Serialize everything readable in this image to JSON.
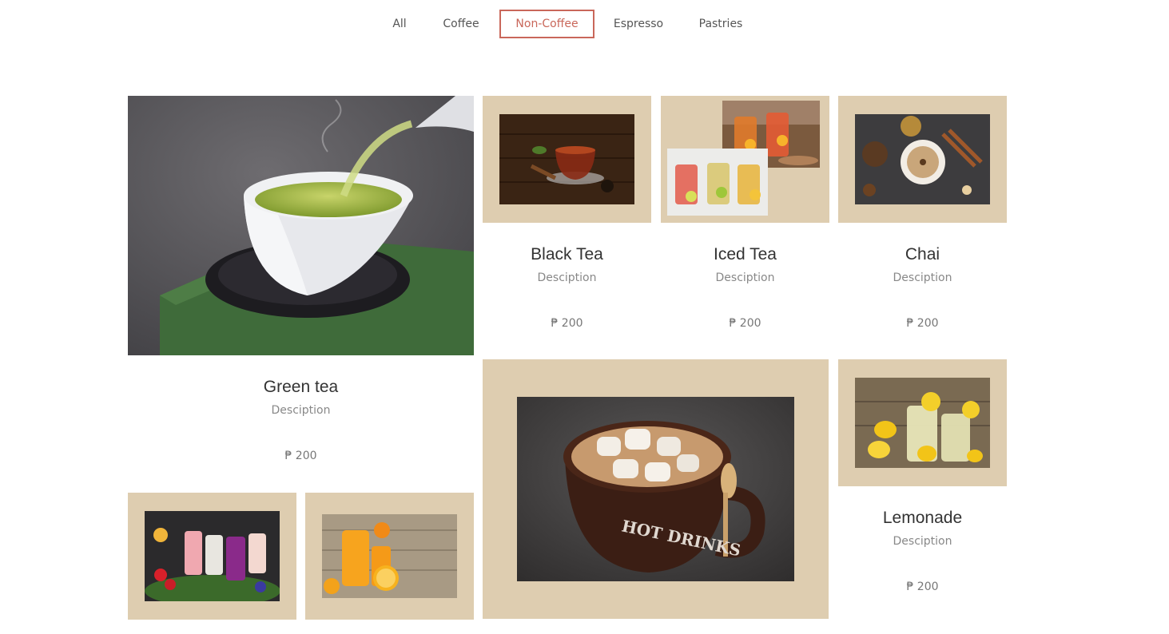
{
  "filters": [
    {
      "label": "All"
    },
    {
      "label": "Coffee"
    },
    {
      "label": "Non-Coffee"
    },
    {
      "label": "Espresso"
    },
    {
      "label": "Pastries"
    }
  ],
  "active_filter": "Non-Coffee",
  "products": {
    "green_tea": {
      "name": "Green tea",
      "description": "Desciption",
      "price": "₱ 200"
    },
    "black_tea": {
      "name": "Black Tea",
      "description": "Desciption",
      "price": "₱ 200"
    },
    "iced_tea": {
      "name": "Iced Tea",
      "description": "Desciption",
      "price": "₱ 200"
    },
    "chai": {
      "name": "Chai",
      "description": "Desciption",
      "price": "₱ 200"
    },
    "lemonade": {
      "name": "Lemonade",
      "description": "Desciption",
      "price": "₱ 200"
    }
  },
  "images": {
    "mug_lettering": "HOT DRINKS"
  },
  "colors": {
    "accent": "#c9675a",
    "card_background": "#decdb0",
    "text": "#333333",
    "muted_text": "#888888"
  }
}
